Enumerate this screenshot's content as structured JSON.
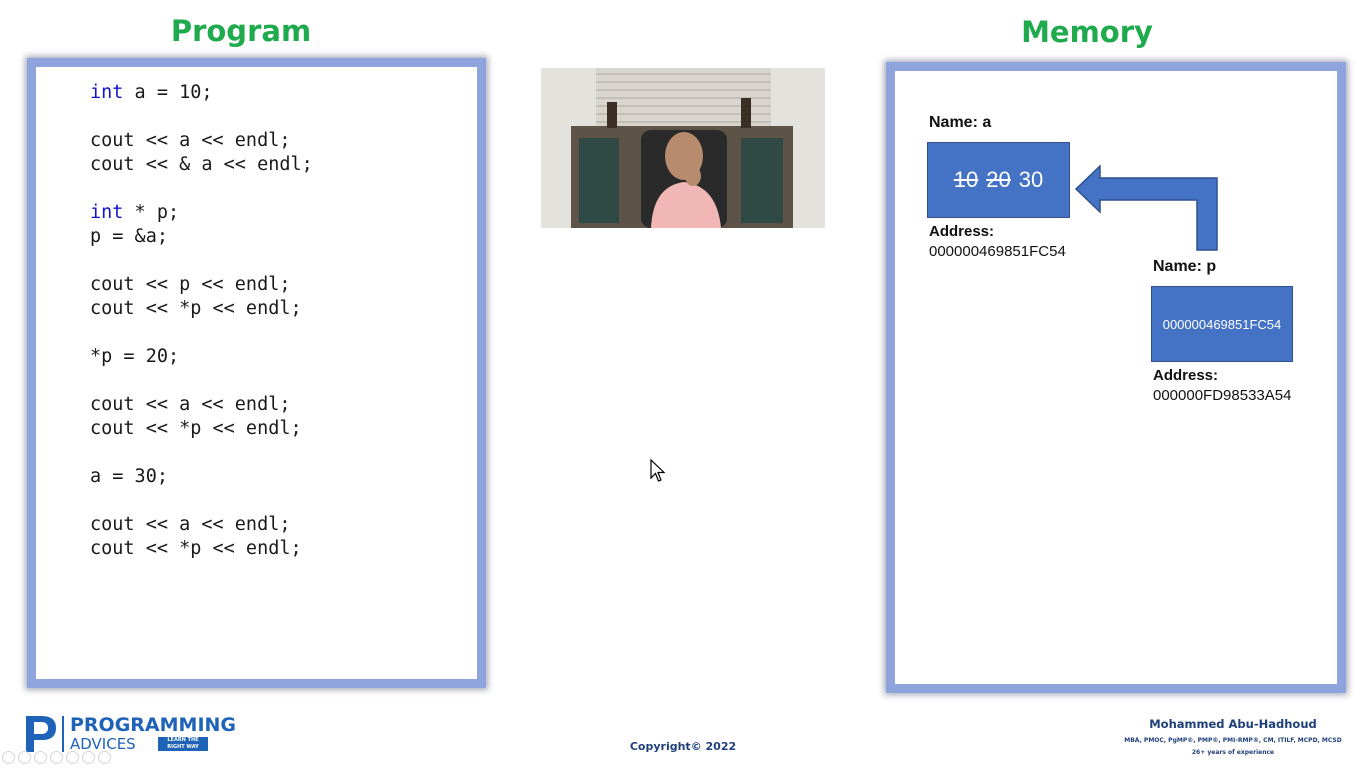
{
  "program_title": "Program",
  "memory_title": "Memory",
  "code_lines": [
    [
      {
        "t": "int",
        "kw": true
      },
      {
        "t": " a = 10;"
      }
    ],
    [],
    [
      {
        "t": "cout << a << endl;"
      }
    ],
    [
      {
        "t": "cout << & a << endl;"
      }
    ],
    [],
    [
      {
        "t": "int",
        "kw": true
      },
      {
        "t": " * p;"
      }
    ],
    [
      {
        "t": "p = &a;"
      }
    ],
    [],
    [
      {
        "t": "cout << p << endl;"
      }
    ],
    [
      {
        "t": "cout << *p << endl;"
      }
    ],
    [],
    [
      {
        "t": "*p = 20;"
      }
    ],
    [],
    [
      {
        "t": "cout << a << endl;"
      }
    ],
    [
      {
        "t": "cout << *p << endl;"
      }
    ],
    [],
    [
      {
        "t": "a = 30;"
      }
    ],
    [],
    [
      {
        "t": "cout << a << endl;"
      }
    ],
    [
      {
        "t": "cout << *p << endl;"
      }
    ]
  ],
  "memory": {
    "var_a": {
      "name_label": "Name: a",
      "old_values": [
        "10",
        "20"
      ],
      "current_value": "30",
      "address_label": "Address:",
      "address": "000000469851FC54"
    },
    "var_p": {
      "name_label": "Name: p",
      "value": "000000469851FC54",
      "address_label": "Address:",
      "address": "000000FD98533A54"
    }
  },
  "footer": {
    "logo_main": "PROGRAMMING",
    "logo_sub": "ADVICES",
    "logo_tag_line1": "LEARN THE",
    "logo_tag_line2": "RIGHT WAY",
    "copyright": "Copyright© 2022",
    "author": "Mohammed Abu-Hadhoud",
    "credentials": "MBA, PMOC, PgMP®, PMP®, PMI-RMP®, CM, ITILF, MCPD, MCSD",
    "experience": "26+ years of experience"
  },
  "colors": {
    "heading_green": "#1faa4e",
    "frame_blue": "#8fa4dc",
    "box_blue": "#4472c4",
    "keyword_blue": "#1515c8",
    "footer_navy": "#1f3f7a"
  }
}
